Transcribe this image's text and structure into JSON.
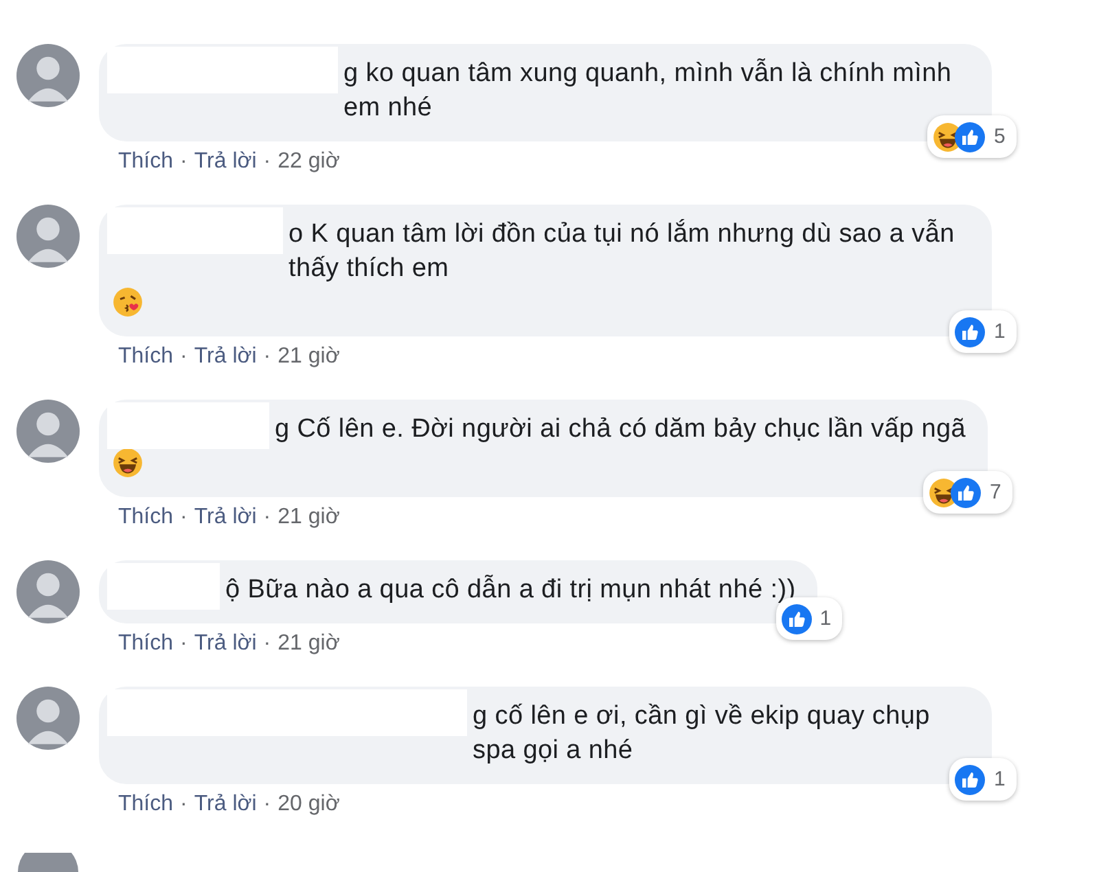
{
  "comments": [
    {
      "text": "g ko quan tâm xung quanh, mình vẫn là chính mình em nhé",
      "meta": [
        {
          "kind": "link",
          "text": "Thích"
        },
        {
          "kind": "sep",
          "text": "·"
        },
        {
          "kind": "link",
          "text": "Trả lời"
        },
        {
          "kind": "sep",
          "text": "·"
        },
        {
          "kind": "time",
          "text": "22 giờ"
        }
      ],
      "reactions": [
        {
          "kind": "haha"
        },
        {
          "kind": "like"
        }
      ],
      "count": "5"
    },
    {
      "text": "o K quan tâm lời đồn của tụi nó lắm nhưng dù sao a vẫn thấy thích em",
      "emoji": {
        "kind": "kiss"
      },
      "meta": [
        {
          "kind": "link",
          "text": "Thích"
        },
        {
          "kind": "sep",
          "text": "·"
        },
        {
          "kind": "link",
          "text": "Trả lời"
        },
        {
          "kind": "sep",
          "text": "·"
        },
        {
          "kind": "time",
          "text": "21 giờ"
        }
      ],
      "reactions": [
        {
          "kind": "like"
        }
      ],
      "count": "1"
    },
    {
      "text": "g Cố lên e. Đời người ai chả có dăm bảy chục lần vấp ngã",
      "emoji": {
        "kind": "laugh"
      },
      "meta": [
        {
          "kind": "link",
          "text": "Thích"
        },
        {
          "kind": "sep",
          "text": "·"
        },
        {
          "kind": "link",
          "text": "Trả lời"
        },
        {
          "kind": "sep",
          "text": "·"
        },
        {
          "kind": "time",
          "text": "21 giờ"
        }
      ],
      "reactions": [
        {
          "kind": "haha"
        },
        {
          "kind": "like"
        }
      ],
      "count": "7"
    },
    {
      "text": "ộ Bữa nào a qua cô dẫn a đi trị mụn nhát nhé :))",
      "meta": [
        {
          "kind": "link",
          "text": "Thích"
        },
        {
          "kind": "sep",
          "text": "·"
        },
        {
          "kind": "link",
          "text": "Trả lời"
        },
        {
          "kind": "sep",
          "text": "·"
        },
        {
          "kind": "time",
          "text": "21 giờ"
        }
      ],
      "reactions": [
        {
          "kind": "like"
        }
      ],
      "count": "1"
    },
    {
      "text": "g cố lên e ơi, cần gì về ekip quay chụp spa gọi a nhé",
      "meta": [
        {
          "kind": "link",
          "text": "Thích"
        },
        {
          "kind": "sep",
          "text": "·"
        },
        {
          "kind": "link",
          "text": "Trả lời"
        },
        {
          "kind": "sep",
          "text": "·"
        },
        {
          "kind": "time",
          "text": "20 giờ"
        }
      ],
      "reactions": [
        {
          "kind": "like"
        }
      ],
      "count": "1"
    }
  ]
}
